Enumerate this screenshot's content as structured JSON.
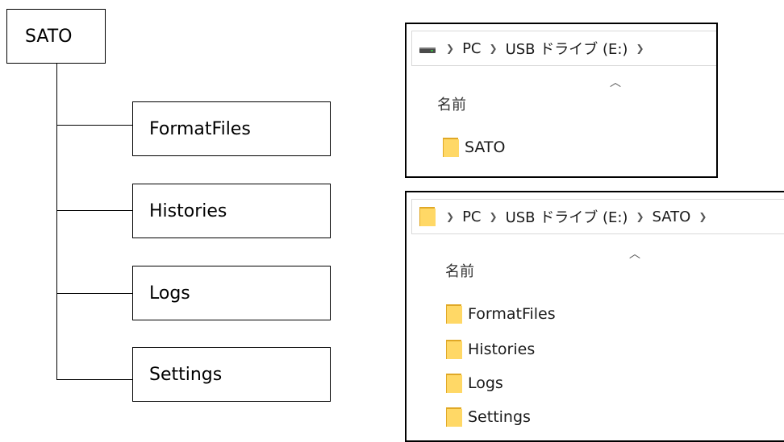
{
  "tree": {
    "root": "SATO",
    "children": [
      "FormatFiles",
      "Histories",
      "Logs",
      "Settings"
    ]
  },
  "explorer1": {
    "breadcrumb": [
      "PC",
      "USB ドライブ (E:)"
    ],
    "column_header": "名前",
    "items": [
      "SATO"
    ]
  },
  "explorer2": {
    "breadcrumb": [
      "PC",
      "USB ドライブ (E:)",
      "SATO"
    ],
    "column_header": "名前",
    "items": [
      "FormatFiles",
      "Histories",
      "Logs",
      "Settings"
    ]
  },
  "icons": {
    "drive": "usb-drive-icon",
    "folder": "folder-icon",
    "separator": "chevron-right-icon",
    "sort": "sort-ascending-icon"
  },
  "colors": {
    "folder_fill": "#FFD866",
    "folder_edge": "#E0A826",
    "drive_body": "#4a4a4a",
    "drive_led": "#3cb043"
  }
}
